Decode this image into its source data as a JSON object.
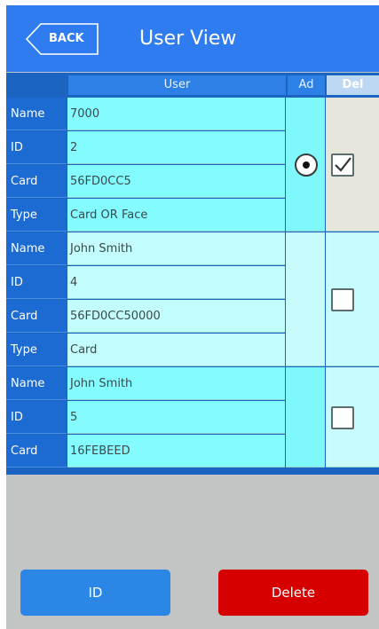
{
  "header": {
    "back_label": "BACK",
    "title": "User View"
  },
  "table": {
    "headers": {
      "user": "User",
      "admin": "Ad",
      "delete": "Del"
    },
    "groups": [
      {
        "rows": [
          {
            "label": "Name",
            "value": "7000"
          },
          {
            "label": "ID",
            "value": "2"
          },
          {
            "label": "Card",
            "value": "56FD0CC5"
          },
          {
            "label": "Type",
            "value": "Card OR Face"
          }
        ],
        "admin_selected": true,
        "delete_checked": true
      },
      {
        "rows": [
          {
            "label": "Name",
            "value": "John Smith"
          },
          {
            "label": "ID",
            "value": "4"
          },
          {
            "label": "Card",
            "value": "56FD0CC50000"
          },
          {
            "label": "Type",
            "value": "Card"
          }
        ],
        "admin_selected": false,
        "delete_checked": false
      },
      {
        "rows": [
          {
            "label": "Name",
            "value": "John Smith"
          },
          {
            "label": "ID",
            "value": "5"
          },
          {
            "label": "Card",
            "value": "16FEBEED"
          }
        ],
        "admin_selected": false,
        "delete_checked": false
      }
    ]
  },
  "footer": {
    "id_label": "ID",
    "delete_label": "Delete"
  },
  "colors": {
    "header": "#2f7cf0",
    "id_button": "#2b86e6",
    "delete_button": "#d60000"
  }
}
